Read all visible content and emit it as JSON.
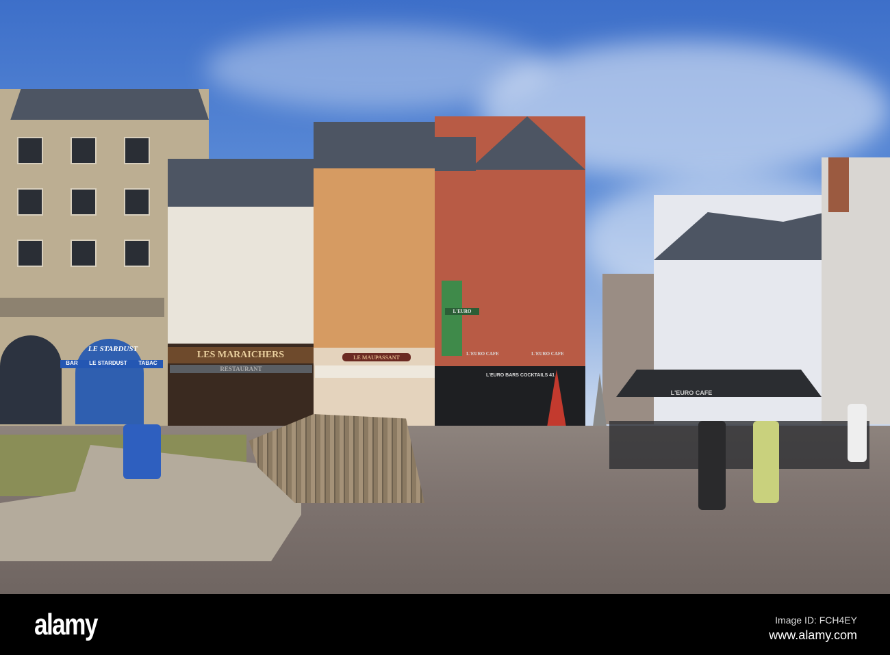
{
  "signs": {
    "stardust_arch": "LE STARDUST",
    "stardust_bar": "BAR",
    "stardust_name": "LE STARDUST",
    "stardust_tabac": "TABAC",
    "maraichers": "LES MARAICHERS",
    "restaurant": "RESTAURANT",
    "maupassant": "LE MAUPASSANT",
    "euro_cafe_facade": "L'EURO CAFE",
    "euro_bars": "L'EURO  BARS  COCKTAILS  41",
    "euro_window_left": "L'EURO",
    "euro_window_right": "L'EURO CAFE",
    "umbrella": "L'EURO CAFE"
  },
  "footer": {
    "logo": "alamy",
    "image_id": "Image ID: FCH4EY",
    "url": "www.alamy.com"
  }
}
